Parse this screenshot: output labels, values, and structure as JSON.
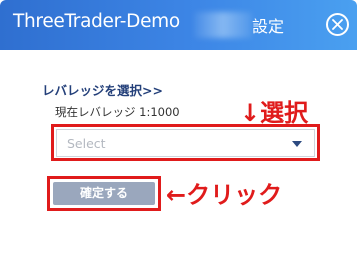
{
  "header": {
    "title": "ThreeTrader-Demo",
    "settings_label": "設定",
    "close_icon": "close-circle-icon"
  },
  "form": {
    "section_label": "レバレッジを選択>>",
    "current_leverage": "現在レバレッジ 1:1000",
    "select_placeholder": "Select",
    "confirm_label": "確定する"
  },
  "annotations": {
    "select_hint": "↓選択",
    "confirm_hint": "←クリック",
    "color": "#e01b1b"
  },
  "colors": {
    "header_gradient_start": "#2f6fd0",
    "header_gradient_end": "#4aa0f0",
    "section_label": "#24407a",
    "confirm_button": "#9aa7bd"
  }
}
